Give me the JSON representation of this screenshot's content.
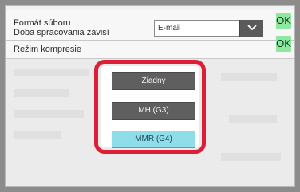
{
  "settings": {
    "file_format_label": "Formát súboru",
    "processing_time_label": "Doba spracovania závisí",
    "file_format_value": "E-mail",
    "compression_label": "Režim kompresie",
    "ok_label": "OK"
  },
  "compression_options": [
    {
      "label": "Žiadny",
      "selected": false
    },
    {
      "label": "MH (G3)",
      "selected": false
    },
    {
      "label": "MMR (G4)",
      "selected": true
    }
  ],
  "colors": {
    "highlight": "#dc1e36",
    "ok_button": "#8ee8a2",
    "selected_option": "#8fdde9",
    "option": "#5f5f5f"
  }
}
